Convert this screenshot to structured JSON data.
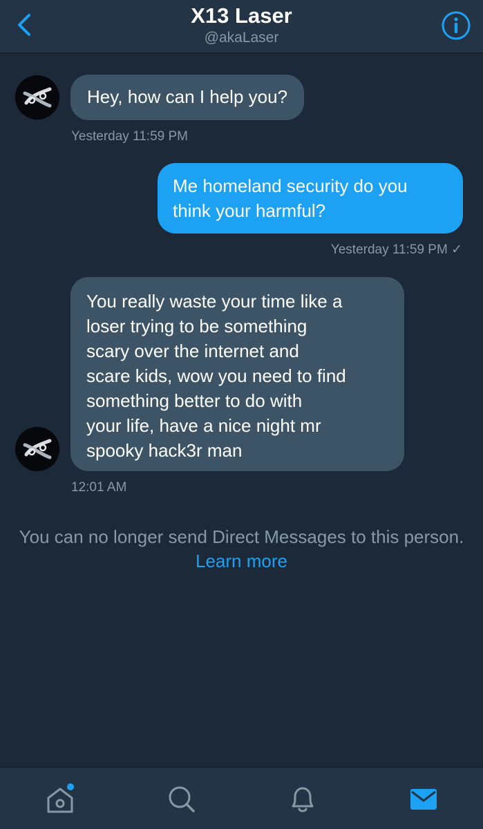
{
  "header": {
    "title": "X13 Laser",
    "handle": "@akaLaser"
  },
  "messages": [
    {
      "direction": "incoming",
      "text": "Hey, how can I help you?",
      "timestamp": "Yesterday 11:59 PM"
    },
    {
      "direction": "outgoing",
      "text": "Me homeland security do you\nthink your harmful?",
      "timestamp": "Yesterday 11:59 PM ✓"
    },
    {
      "direction": "incoming",
      "text": "You really waste your time like a\nloser trying to be something\nscary over the internet and\nscare kids, wow you need to find\nsomething better to do with\nyour life, have a nice night mr\nspooky hack3r man",
      "timestamp": "12:01 AM"
    }
  ],
  "notice": {
    "text": "You can no longer send Direct Messages to this person.",
    "link": "Learn more"
  },
  "tabbar": {
    "items": [
      {
        "icon": "home-icon",
        "active": false,
        "has_notification_dot": true
      },
      {
        "icon": "search-icon",
        "active": false
      },
      {
        "icon": "bell-icon",
        "active": false
      },
      {
        "icon": "mail-icon",
        "active": true
      }
    ]
  },
  "colors": {
    "background": "#1c2938",
    "header": "#243447",
    "accent": "#1da1f2",
    "incoming_bubble": "#3d5466",
    "secondary_text": "#8899a6"
  }
}
